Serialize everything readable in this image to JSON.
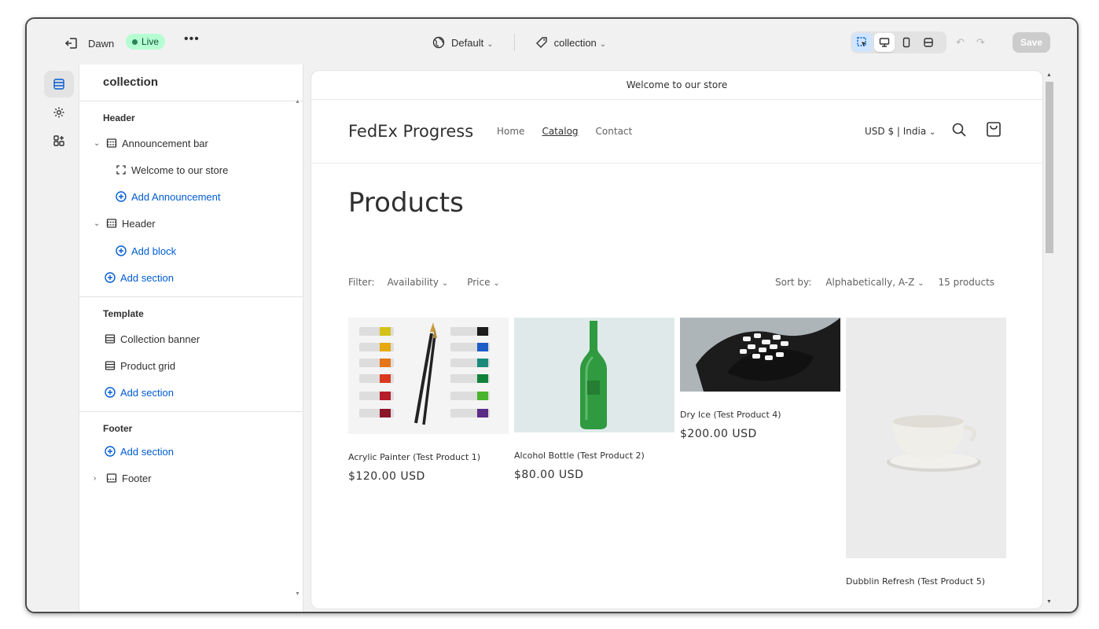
{
  "topbar": {
    "theme_name": "Dawn",
    "live_label": "Live",
    "more_label": "•••",
    "template_label": "Default",
    "page_label": "collection",
    "save_label": "Save"
  },
  "panel": {
    "title": "collection",
    "header_group": {
      "label": "Header",
      "announcement_bar": "Announcement bar",
      "announcement_block": "Welcome to our store",
      "add_announcement": "Add Announcement",
      "header": "Header",
      "add_block": "Add block",
      "add_section": "Add section"
    },
    "template_group": {
      "label": "Template",
      "collection_banner": "Collection banner",
      "product_grid": "Product grid",
      "add_section": "Add section"
    },
    "footer_group": {
      "label": "Footer",
      "add_section": "Add section",
      "footer": "Footer"
    }
  },
  "store": {
    "announcement": "Welcome to our store",
    "logo": "FedEx Progress",
    "nav": [
      "Home",
      "Catalog",
      "Contact"
    ],
    "locale": "USD $ | India",
    "heading": "Products",
    "filter_label": "Filter:",
    "filter_availability": "Availability",
    "filter_price": "Price",
    "sort_label": "Sort by:",
    "sort_value": "Alphabetically, A-Z",
    "product_count": "15 products",
    "products": [
      {
        "name": "Acrylic Painter (Test Product 1)",
        "price": "$120.00 USD"
      },
      {
        "name": "Alcohol Bottle (Test Product 2)",
        "price": "$80.00 USD"
      },
      {
        "name": "Dry Ice (Test Product 4)",
        "price": "$200.00 USD"
      },
      {
        "name": "Dubblin Refresh (Test Product 5)",
        "price": ""
      }
    ]
  },
  "colors": {
    "accent": "#005bd3",
    "live_bg": "#b4fed2",
    "live_dot": "#29845a"
  }
}
